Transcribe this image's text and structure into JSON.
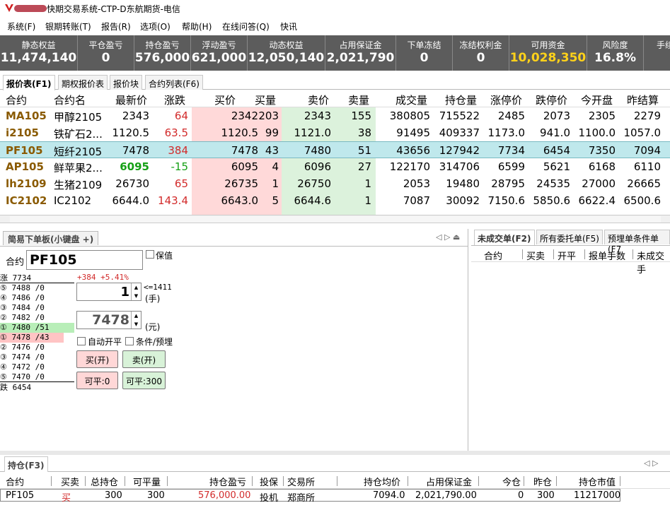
{
  "window": {
    "title": "快期交易系统-CTP-D东航期货-电信"
  },
  "menu": [
    "系统(F)",
    "银期转账(T)",
    "报告(R)",
    "选项(O)",
    "帮助(H)",
    "在线问答(Q)",
    "快讯"
  ],
  "stats": [
    {
      "label": "静态权益",
      "value": "11,474,140"
    },
    {
      "label": "平仓盈亏",
      "value": "0"
    },
    {
      "label": "持仓盈亏",
      "value": "576,000"
    },
    {
      "label": "浮动盈亏",
      "value": "621,000"
    },
    {
      "label": "动态权益",
      "value": "12,050,140"
    },
    {
      "label": "占用保证金",
      "value": "2,021,790"
    },
    {
      "label": "下单冻结",
      "value": "0"
    },
    {
      "label": "冻结权利金",
      "value": "0"
    },
    {
      "label": "可用资金",
      "value": "10,028,350"
    },
    {
      "label": "风险度",
      "value": "16.8%"
    },
    {
      "label": "手续",
      "value": ""
    }
  ],
  "quote_tabs": [
    "报价表(F1)",
    "期权报价表",
    "报价块",
    "合约列表(F6)"
  ],
  "quote_columns": [
    "合约",
    "合约名",
    "最新价",
    "涨跌",
    "买价",
    "买量",
    "卖价",
    "卖量",
    "成交量",
    "持仓量",
    "涨停价",
    "跌停价",
    "今开盘",
    "昨结算"
  ],
  "quote_rows": [
    {
      "code": "MA105",
      "name": "甲醇2105",
      "last": "2343",
      "chg": "64",
      "bid": "2342",
      "bidv": "203",
      "ask": "2343",
      "askv": "155",
      "vol": "380805",
      "oi": "715522",
      "up": "2485",
      "down": "2073",
      "open": "2305",
      "pre": "2279"
    },
    {
      "code": "i2105",
      "name": "铁矿石2...",
      "last": "1120.5",
      "chg": "63.5",
      "bid": "1120.5",
      "bidv": "99",
      "ask": "1121.0",
      "askv": "38",
      "vol": "91495",
      "oi": "409337",
      "up": "1173.0",
      "down": "941.0",
      "open": "1100.0",
      "pre": "1057.0"
    },
    {
      "code": "PF105",
      "name": "短纤2105",
      "last": "7478",
      "chg": "384",
      "bid": "7478",
      "bidv": "43",
      "ask": "7480",
      "askv": "51",
      "vol": "43656",
      "oi": "127942",
      "up": "7734",
      "down": "6454",
      "open": "7350",
      "pre": "7094"
    },
    {
      "code": "AP105",
      "name": "鲜苹果2...",
      "last": "6095",
      "chg": "-15",
      "bid": "6095",
      "bidv": "4",
      "ask": "6096",
      "askv": "27",
      "vol": "122170",
      "oi": "314706",
      "up": "6599",
      "down": "5621",
      "open": "6168",
      "pre": "6110"
    },
    {
      "code": "lh2109",
      "name": "生猪2109",
      "last": "26730",
      "chg": "65",
      "bid": "26735",
      "bidv": "1",
      "ask": "26750",
      "askv": "1",
      "vol": "2053",
      "oi": "19480",
      "up": "28795",
      "down": "24535",
      "open": "27000",
      "pre": "26665"
    },
    {
      "code": "IC2102",
      "name": "IC2102",
      "last": "6644.0",
      "chg": "143.4",
      "bid": "6643.0",
      "bidv": "5",
      "ask": "6644.6",
      "askv": "1",
      "vol": "7087",
      "oi": "30092",
      "up": "7150.6",
      "down": "5850.6",
      "open": "6622.4",
      "pre": "6500.6"
    }
  ],
  "order_panel": {
    "tab": "简易下单板(小键盘 +)",
    "contract_label": "合约",
    "contract_value": "PF105",
    "hedge_label": "保值",
    "change_text": "+384 +5.41%",
    "qty_value": "1",
    "qty_limit": "<=1411",
    "qty_unit": "(手)",
    "price_value": "7478",
    "price_unit": "(元)",
    "auto_label": "自动开平",
    "cond_label": "条件/预埋",
    "buy_label": "买(开)",
    "sell_label": "卖(开)",
    "close_buy_label": "可平:0",
    "close_sell_label": "可平:300",
    "ladder": [
      "涨 7734",
      "⑤ 7488 /0",
      "④ 7486 /0",
      "③ 7484 /0",
      "② 7482 /0",
      "① 7480 /51",
      "① 7478 /43",
      "② 7476 /0",
      "③ 7474 /0",
      "④ 7472 /0",
      "⑤ 7470 /0",
      "跌 6454"
    ]
  },
  "right_panel": {
    "tabs": [
      "未成交单(F2)",
      "所有委托单(F5)",
      "预埋单条件单(F7"
    ],
    "columns": [
      "合约",
      "买卖",
      "开平",
      "报单手数",
      "未成交手"
    ]
  },
  "positions": {
    "tab": "持仓(F3)",
    "columns": [
      "合约",
      "买卖",
      "总持仓",
      "可平量",
      "持仓盈亏",
      "投保",
      "交易所",
      "持仓均价",
      "占用保证金",
      "今仓",
      "昨仓",
      "持仓市值"
    ],
    "row": {
      "code": "PF105",
      "side": "买",
      "total": "300",
      "avail": "300",
      "pnl": "576,000.00",
      "hedge": "投机",
      "exch": "郑商所",
      "avg": "7094.0",
      "margin": "2,021,790.00",
      "today": "0",
      "yest": "300",
      "mv": "11217000"
    }
  }
}
